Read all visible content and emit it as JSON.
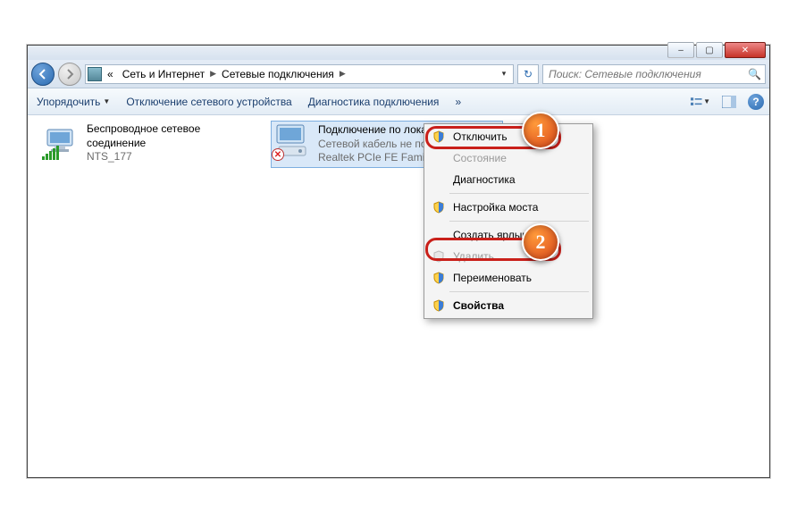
{
  "window": {
    "controls": {
      "min": "–",
      "max": "▢",
      "close": "✕"
    }
  },
  "breadcrumb": {
    "prefix": "«",
    "part1": "Сеть и Интернет",
    "part2": "Сетевые подключения"
  },
  "search": {
    "placeholder": "Поиск: Сетевые подключения"
  },
  "toolbar": {
    "organize": "Упорядочить",
    "disable_device": "Отключение сетевого устройства",
    "diagnostics": "Диагностика подключения",
    "more": "»"
  },
  "connections": {
    "wifi": {
      "title": "Беспроводное сетевое соединение",
      "ssid": "NTS_177"
    },
    "lan": {
      "title": "Подключение по локальной сети",
      "status": "Сетевой кабель не подключен",
      "adapter": "Realtek PCIe FE Family"
    }
  },
  "context_menu": {
    "disable": "Отключить",
    "state": "Состояние",
    "diagnostics": "Диагностика",
    "bridge": "Настройка моста",
    "shortcut": "Создать ярлык",
    "delete": "Удалить",
    "rename": "Переименовать",
    "properties": "Свойства"
  },
  "markers": {
    "m1": "1",
    "m2": "2"
  }
}
